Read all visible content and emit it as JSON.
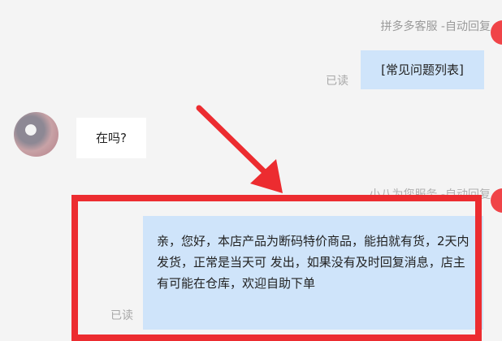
{
  "messages": [
    {
      "sender": "拼多多客服 -自动回复",
      "text": "[常见问题列表]",
      "status": "已读"
    },
    {
      "text": "在吗?"
    },
    {
      "sender": "小八为您服务 -自动回复",
      "text": "亲，您好，本店产品为断码特价商品，能拍就有货，2天内发货，正常是当天可 发出，如果没有及时回复消息，店主有可能在仓库，欢迎自助下单",
      "status": "已读"
    }
  ],
  "colors": {
    "highlight": "#ec2c30",
    "bubble_blue": "#cfe4fa",
    "background": "#f4f4f4"
  }
}
